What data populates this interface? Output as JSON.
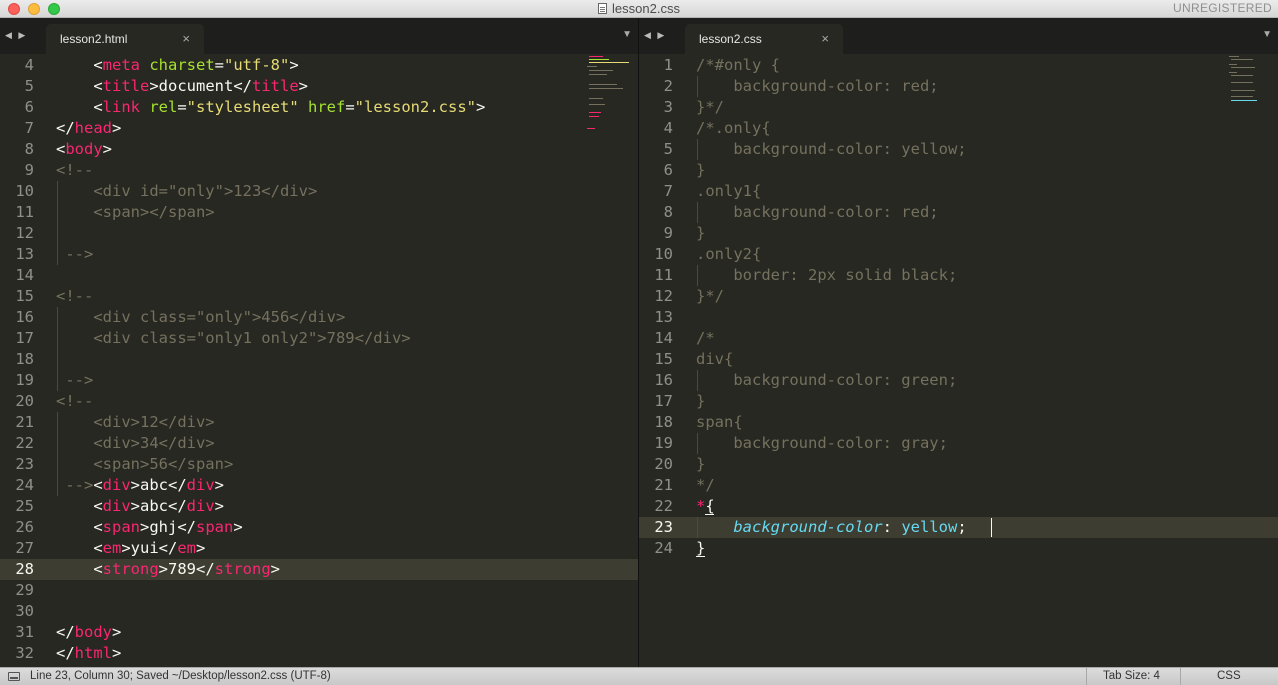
{
  "window": {
    "title": "lesson2.css",
    "unregistered": "UNREGISTERED"
  },
  "left_pane": {
    "tab_label": "lesson2.html",
    "lines": [
      {
        "n": "4",
        "segs": [
          [
            "p",
            "    <"
          ],
          [
            "t",
            "meta"
          ],
          [
            "a",
            " charset"
          ],
          [
            "p",
            "="
          ],
          [
            "s",
            "\"utf-8\""
          ],
          [
            "p",
            ">"
          ]
        ]
      },
      {
        "n": "5",
        "segs": [
          [
            "p",
            "    <"
          ],
          [
            "t",
            "title"
          ],
          [
            "p",
            ">document</"
          ],
          [
            "t",
            "title"
          ],
          [
            "p",
            ">"
          ]
        ]
      },
      {
        "n": "6",
        "segs": [
          [
            "p",
            "    <"
          ],
          [
            "t",
            "link"
          ],
          [
            "a",
            " rel"
          ],
          [
            "p",
            "="
          ],
          [
            "s",
            "\"stylesheet\""
          ],
          [
            "a",
            " href"
          ],
          [
            "p",
            "="
          ],
          [
            "s",
            "\"lesson2.css\""
          ],
          [
            "p",
            ">"
          ]
        ]
      },
      {
        "n": "7",
        "segs": [
          [
            "p",
            "</"
          ],
          [
            "t",
            "head"
          ],
          [
            "p",
            ">"
          ]
        ]
      },
      {
        "n": "8",
        "segs": [
          [
            "p",
            "<"
          ],
          [
            "t",
            "body"
          ],
          [
            "p",
            ">"
          ]
        ]
      },
      {
        "n": "9",
        "segs": [
          [
            "c",
            "<!--"
          ]
        ]
      },
      {
        "n": "10",
        "segs": [
          [
            "c",
            "    <div id=\"only\">123</div>"
          ]
        ]
      },
      {
        "n": "11",
        "segs": [
          [
            "c",
            "    <span></span>"
          ]
        ]
      },
      {
        "n": "12",
        "segs": [
          [
            "c",
            ""
          ]
        ]
      },
      {
        "n": "13",
        "segs": [
          [
            "c",
            " -->"
          ]
        ]
      },
      {
        "n": "14",
        "segs": [
          [
            "p",
            ""
          ]
        ]
      },
      {
        "n": "15",
        "segs": [
          [
            "c",
            "<!--"
          ]
        ]
      },
      {
        "n": "16",
        "segs": [
          [
            "c",
            "    <div class=\"only\">456</div>"
          ]
        ]
      },
      {
        "n": "17",
        "segs": [
          [
            "c",
            "    <div class=\"only1 only2\">789</div>"
          ]
        ]
      },
      {
        "n": "18",
        "segs": [
          [
            "c",
            ""
          ]
        ]
      },
      {
        "n": "19",
        "segs": [
          [
            "c",
            " -->"
          ]
        ]
      },
      {
        "n": "20",
        "segs": [
          [
            "c",
            "<!--"
          ]
        ]
      },
      {
        "n": "21",
        "segs": [
          [
            "c",
            "    <div>12</div>"
          ]
        ]
      },
      {
        "n": "22",
        "segs": [
          [
            "c",
            "    <div>34</div>"
          ]
        ]
      },
      {
        "n": "23",
        "segs": [
          [
            "c",
            "    <span>56</span>"
          ]
        ]
      },
      {
        "n": "24",
        "segs": [
          [
            "c",
            " -->"
          ],
          [
            "p",
            "<"
          ],
          [
            "t",
            "div"
          ],
          [
            "p",
            ">abc</"
          ],
          [
            "t",
            "div"
          ],
          [
            "p",
            ">"
          ]
        ]
      },
      {
        "n": "25",
        "segs": [
          [
            "p",
            "    <"
          ],
          [
            "t",
            "div"
          ],
          [
            "p",
            ">abc</"
          ],
          [
            "t",
            "div"
          ],
          [
            "p",
            ">"
          ]
        ]
      },
      {
        "n": "26",
        "segs": [
          [
            "p",
            "    <"
          ],
          [
            "t",
            "span"
          ],
          [
            "p",
            ">ghj</"
          ],
          [
            "t",
            "span"
          ],
          [
            "p",
            ">"
          ]
        ]
      },
      {
        "n": "27",
        "segs": [
          [
            "p",
            "    <"
          ],
          [
            "t",
            "em"
          ],
          [
            "p",
            ">yui</"
          ],
          [
            "t",
            "em"
          ],
          [
            "p",
            ">"
          ]
        ]
      },
      {
        "n": "28",
        "segs": [
          [
            "p",
            "    <"
          ],
          [
            "t",
            "strong"
          ],
          [
            "p",
            ">789</"
          ],
          [
            "t",
            "strong"
          ],
          [
            "p",
            ">"
          ]
        ]
      },
      {
        "n": "29",
        "segs": [
          [
            "p",
            ""
          ]
        ]
      },
      {
        "n": "30",
        "segs": [
          [
            "p",
            ""
          ]
        ]
      },
      {
        "n": "31",
        "segs": [
          [
            "p",
            "</"
          ],
          [
            "t",
            "body"
          ],
          [
            "p",
            ">"
          ]
        ]
      },
      {
        "n": "32",
        "segs": [
          [
            "p",
            "</"
          ],
          [
            "t",
            "html"
          ],
          [
            "p",
            ">"
          ]
        ]
      }
    ],
    "current_line": "28"
  },
  "right_pane": {
    "tab_label": "lesson2.css",
    "lines": [
      {
        "n": "1",
        "segs": [
          [
            "c",
            "/*#only {"
          ]
        ]
      },
      {
        "n": "2",
        "segs": [
          [
            "c",
            "    background-color: red;"
          ]
        ]
      },
      {
        "n": "3",
        "segs": [
          [
            "c",
            "}*/"
          ]
        ]
      },
      {
        "n": "4",
        "segs": [
          [
            "c",
            "/*.only{"
          ]
        ]
      },
      {
        "n": "5",
        "segs": [
          [
            "c",
            "    background-color: yellow;"
          ]
        ]
      },
      {
        "n": "6",
        "segs": [
          [
            "c",
            "}"
          ]
        ]
      },
      {
        "n": "7",
        "segs": [
          [
            "c",
            ".only1{"
          ]
        ]
      },
      {
        "n": "8",
        "segs": [
          [
            "c",
            "    background-color: red;"
          ]
        ]
      },
      {
        "n": "9",
        "segs": [
          [
            "c",
            "}"
          ]
        ]
      },
      {
        "n": "10",
        "segs": [
          [
            "c",
            ".only2{"
          ]
        ]
      },
      {
        "n": "11",
        "segs": [
          [
            "c",
            "    border: 2px solid black;"
          ]
        ]
      },
      {
        "n": "12",
        "segs": [
          [
            "c",
            "}*/"
          ]
        ]
      },
      {
        "n": "13",
        "segs": [
          [
            "c",
            ""
          ]
        ]
      },
      {
        "n": "14",
        "segs": [
          [
            "c",
            "/*"
          ]
        ]
      },
      {
        "n": "15",
        "segs": [
          [
            "c",
            "div{"
          ]
        ]
      },
      {
        "n": "16",
        "segs": [
          [
            "c",
            "    background-color: green;"
          ]
        ]
      },
      {
        "n": "17",
        "segs": [
          [
            "c",
            "}"
          ]
        ]
      },
      {
        "n": "18",
        "segs": [
          [
            "c",
            "span{"
          ]
        ]
      },
      {
        "n": "19",
        "segs": [
          [
            "c",
            "    background-color: gray;"
          ]
        ]
      },
      {
        "n": "20",
        "segs": [
          [
            "c",
            "}"
          ]
        ]
      },
      {
        "n": "21",
        "segs": [
          [
            "c",
            "*/"
          ]
        ]
      },
      {
        "n": "22",
        "segs": [
          [
            "t",
            "*"
          ],
          [
            "p",
            "{"
          ]
        ]
      },
      {
        "n": "23",
        "segs": [
          [
            "p",
            "    "
          ],
          [
            "i",
            "background-color"
          ],
          [
            "p",
            ": "
          ],
          [
            "k",
            "yellow"
          ],
          [
            "p",
            ";"
          ]
        ]
      },
      {
        "n": "24",
        "segs": [
          [
            "p",
            "}"
          ]
        ]
      }
    ],
    "current_line": "23"
  },
  "status_bar": {
    "position": "Line 23, Column 30; Saved ~/Desktop/lesson2.css (UTF-8)",
    "tab_size": "Tab Size: 4",
    "syntax": "CSS"
  },
  "colors": {
    "background": "#272822",
    "tag": "#f92672",
    "attribute": "#a6e22e",
    "string": "#e6db74",
    "comment": "#75715e",
    "property": "#66d9ef"
  }
}
